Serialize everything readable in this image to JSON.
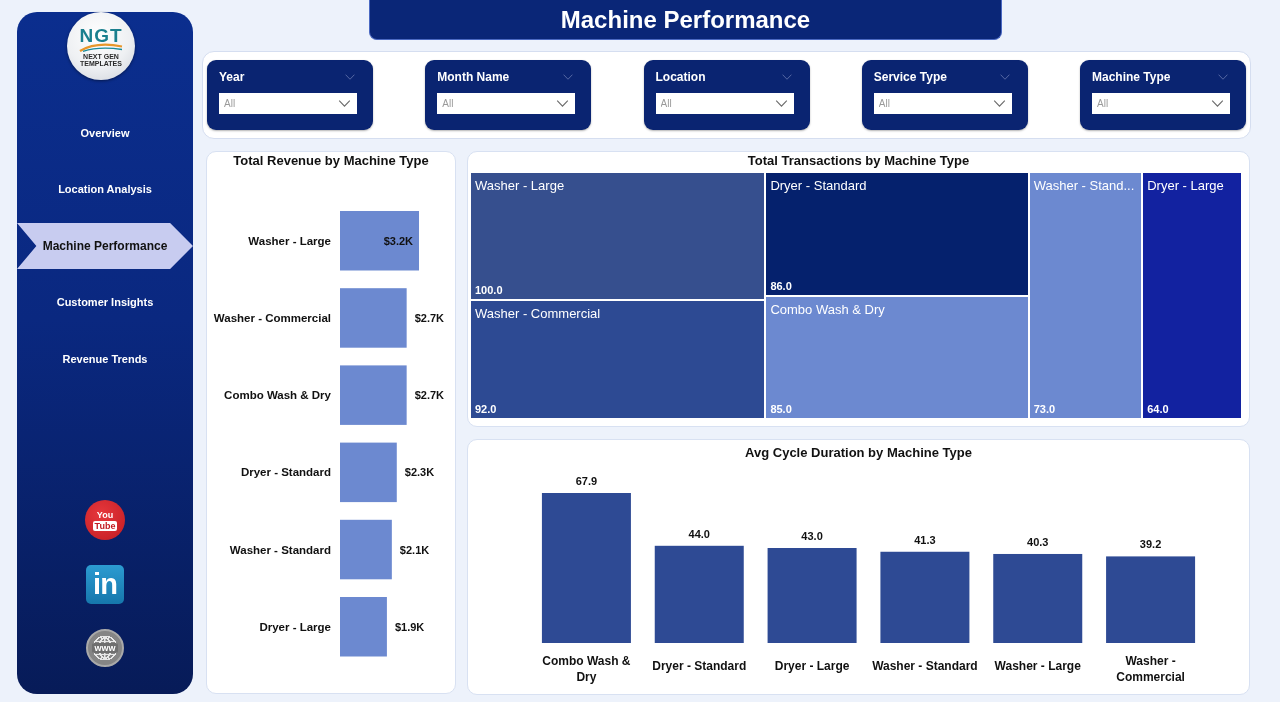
{
  "sidebar": {
    "logo": {
      "text": "NGT",
      "tagline": "NEXT GEN TEMPLATES"
    },
    "nav": [
      {
        "label": "Overview",
        "selected": false
      },
      {
        "label": "Location Analysis",
        "selected": false
      },
      {
        "label": "Machine Performance",
        "selected": true
      },
      {
        "label": "Customer Insights",
        "selected": false
      },
      {
        "label": "Revenue Trends",
        "selected": false
      }
    ],
    "social": [
      {
        "kind": "youtube",
        "lines": [
          "You",
          "Tube"
        ]
      },
      {
        "kind": "linkedin",
        "lines": [
          "in"
        ]
      },
      {
        "kind": "website",
        "lines": [
          "www"
        ]
      }
    ]
  },
  "title": "Machine Performance",
  "filters": [
    {
      "label": "Year",
      "placeholder": "All"
    },
    {
      "label": "Month Name",
      "placeholder": "All"
    },
    {
      "label": "Location",
      "placeholder": "All"
    },
    {
      "label": "Service Type",
      "placeholder": "All"
    },
    {
      "label": "Machine Type",
      "placeholder": "All"
    }
  ],
  "revenue_panel": {
    "chart_data": {
      "type": "bar",
      "orientation": "horizontal",
      "title": "Total Revenue by Machine Type",
      "categories": [
        "Washer - Large",
        "Washer - Commercial",
        "Combo Wash & Dry",
        "Dryer - Standard",
        "Washer - Standard",
        "Dryer - Large"
      ],
      "values": [
        3200,
        2700,
        2700,
        2300,
        2100,
        1900
      ],
      "value_labels": [
        "$3.2K",
        "$2.7K",
        "$2.7K",
        "$2.3K",
        "$2.1K",
        "$1.9K"
      ]
    }
  },
  "transactions_treemap": {
    "title": "Total Transactions by Machine Type",
    "columns": [
      {
        "tiles": [
          {
            "machine_type": "Washer - Large",
            "transactions": "100.0",
            "color": "#364f8e"
          },
          {
            "machine_type": "Washer - Commercial",
            "transactions": "92.0",
            "color": "#2d4a93"
          }
        ]
      },
      {
        "tiles": [
          {
            "machine_type": "Dryer - Standard",
            "transactions": "86.0",
            "color": "#05216d"
          },
          {
            "machine_type": "Combo Wash & Dry",
            "transactions": "85.0",
            "color": "#6c89d0"
          }
        ]
      },
      {
        "tiles": [
          {
            "machine_type": "Washer - Stand...",
            "transactions": "73.0",
            "color": "#6c89d0"
          }
        ]
      },
      {
        "tiles": [
          {
            "machine_type": "Dryer - Large",
            "transactions": "64.0",
            "color": "#1222a0"
          }
        ]
      }
    ]
  },
  "cycle_panel": {
    "chart_data": {
      "type": "bar",
      "orientation": "vertical",
      "title": "Avg Cycle Duration by Machine Type",
      "categories": [
        "Combo Wash & Dry",
        "Dryer - Standard",
        "Dryer - Large",
        "Washer - Standard",
        "Washer - Large",
        "Washer - Commercial"
      ],
      "values": [
        67.9,
        44.0,
        43.0,
        41.3,
        40.3,
        39.2
      ],
      "value_labels": [
        "67.9",
        "44.0",
        "43.0",
        "41.3",
        "40.3",
        "39.2"
      ]
    }
  }
}
